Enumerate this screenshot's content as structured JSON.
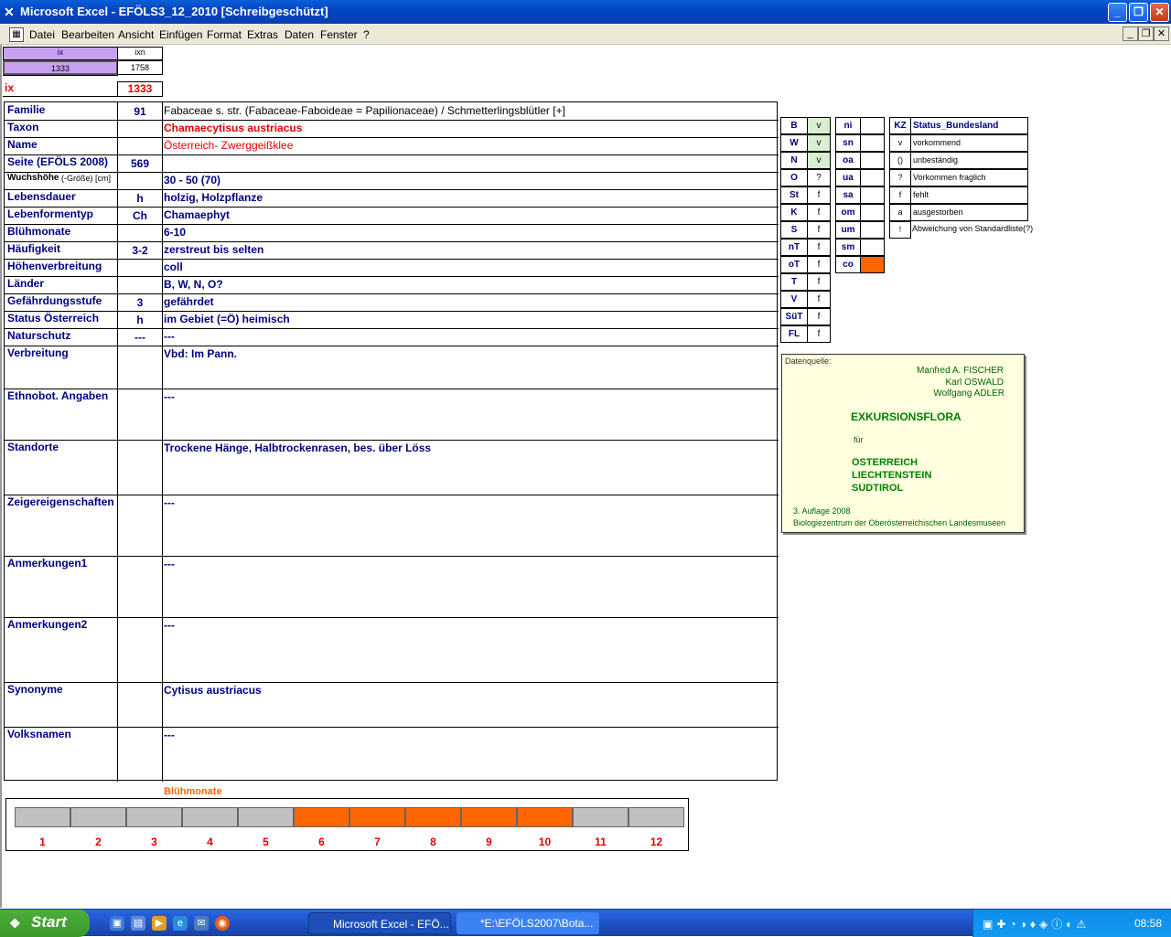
{
  "window": {
    "title": "Microsoft Excel - EFÖLS3_12_2010  [Schreibgeschützt]",
    "icon": "excel-icon"
  },
  "menu": [
    "Datei",
    "Bearbeiten",
    "Ansicht",
    "Einfügen",
    "Format",
    "Extras",
    "Daten",
    "Fenster",
    "?"
  ],
  "top": {
    "ix_label": "ix",
    "ixn_label": "ixn",
    "ix_val": "1333",
    "ixn_val": "1758",
    "ix_row_label": "ix",
    "ix_row_val": "1333"
  },
  "rows": [
    {
      "label": "Familie",
      "code": "91",
      "value": "Fabaceae s. str. (Fabaceae-Faboideae = Papilionaceae)  /  Schmetterlingsblütler [+]"
    },
    {
      "label": "Taxon",
      "code": "",
      "value": "Chamaecytisus austriacus"
    },
    {
      "label": "Name",
      "code": "",
      "value": "Österreich- Zwerggeißklee"
    },
    {
      "label": "Seite (EFÖLS 2008)",
      "code": "569",
      "value": ""
    },
    {
      "label": "Wuchshöhe",
      "label_small": "(-Größe) [cm]",
      "code": "",
      "value": " 30 - 50 (70)"
    },
    {
      "label": "Lebensdauer",
      "code": "h",
      "value": "holzig, Holzpflanze"
    },
    {
      "label": "Lebenformentyp",
      "code": "Ch",
      "value": "Chamaephyt"
    },
    {
      "label": "Blühmonate",
      "code": "",
      "value": " 6-10"
    },
    {
      "label": "Häufigkeit",
      "code": "3-2",
      "value": "zerstreut bis selten"
    },
    {
      "label": "Höhenverbreitung",
      "code": "",
      "value": "coll"
    },
    {
      "label": "Länder",
      "code": "",
      "value": "B, W, N, O?"
    },
    {
      "label": "Gefährdungsstufe",
      "code": "3",
      "value": "gefährdet"
    },
    {
      "label": "Status Österreich",
      "code": "h",
      "value": "im Gebiet (=Ö) heimisch"
    },
    {
      "label": "Naturschutz",
      "code": "---",
      "value": "---"
    },
    {
      "label": "Verbreitung",
      "code": "",
      "value": "Vbd:  Im Pann."
    },
    {
      "label": "Ethnobot. Angaben",
      "code": "",
      "value": "---"
    },
    {
      "label": "Standorte",
      "code": "",
      "value": "Trockene Hänge, Halbtrockenrasen, bes. über Löss"
    },
    {
      "label": "Zeigereigenschaften",
      "code": "",
      "value": "---"
    },
    {
      "label": "Anmerkungen1",
      "code": "",
      "value": "---"
    },
    {
      "label": "Anmerkungen2",
      "code": "",
      "value": "---"
    },
    {
      "label": "Synonyme",
      "code": "",
      "value": "Cytisus austriacus"
    },
    {
      "label": "Volksnamen",
      "code": "",
      "value": "---"
    }
  ],
  "states": [
    {
      "abbr": "B",
      "val": "v",
      "green": true
    },
    {
      "abbr": "W",
      "val": "v",
      "green": true
    },
    {
      "abbr": "N",
      "val": "v",
      "green": true
    },
    {
      "abbr": "O",
      "val": "?",
      "green": false
    },
    {
      "abbr": "St",
      "val": "f",
      "green": false
    },
    {
      "abbr": "K",
      "val": "f",
      "green": false
    },
    {
      "abbr": "S",
      "val": "f",
      "green": false
    },
    {
      "abbr": "nT",
      "val": "f",
      "green": false
    },
    {
      "abbr": "oT",
      "val": "f",
      "green": false
    },
    {
      "abbr": "T",
      "val": "f",
      "green": false
    },
    {
      "abbr": "V",
      "val": "f",
      "green": false
    },
    {
      "abbr": "SüT",
      "val": "f",
      "green": false
    },
    {
      "abbr": "FL",
      "val": "f",
      "green": false
    }
  ],
  "altitudes": [
    {
      "abbr": "ni",
      "on": false
    },
    {
      "abbr": "sn",
      "on": false
    },
    {
      "abbr": "oa",
      "on": false
    },
    {
      "abbr": "ua",
      "on": false
    },
    {
      "abbr": "sa",
      "on": false
    },
    {
      "abbr": "om",
      "on": false
    },
    {
      "abbr": "um",
      "on": false
    },
    {
      "abbr": "sm",
      "on": false
    },
    {
      "abbr": "co",
      "on": true
    }
  ],
  "kz": {
    "header_kz": "KZ",
    "header_status": "Status_Bundesland",
    "items": [
      {
        "k": "v",
        "t": "vorkommend"
      },
      {
        "k": "()",
        "t": "unbeständig"
      },
      {
        "k": "?",
        "t": "Vorkommen fraglich"
      },
      {
        "k": "f",
        "t": "fehlt"
      },
      {
        "k": "a",
        "t": "ausgestorben"
      },
      {
        "k": "!",
        "t": "Abweichung von Standardliste(?)"
      }
    ]
  },
  "source": {
    "label": "Datenquelle:",
    "authors": [
      "Manfred A. FISCHER",
      "Karl OSWALD",
      "Wolfgang ADLER"
    ],
    "title": "EXKURSIONSFLORA",
    "fuer": "für",
    "countries": [
      "ÖSTERREICH",
      "LIECHTENSTEIN",
      "SÜDTIROL"
    ],
    "edition": "3. Auflage 2008",
    "publisher": "Biologiezentrum der Oberösterreichischen Landesmuseen"
  },
  "bluehmonate": {
    "title": "Blühmonate",
    "months": [
      "1",
      "2",
      "3",
      "4",
      "5",
      "6",
      "7",
      "8",
      "9",
      "10",
      "11",
      "12"
    ],
    "active": [
      6,
      7,
      8,
      9,
      10
    ]
  },
  "taskbar": {
    "start": "Start",
    "tasks": [
      "Microsoft Excel - EFÖ...",
      "*E:\\EFÖLS2007\\Bota..."
    ],
    "clock": "08:58"
  },
  "colors": {
    "accent_orange": "#ff6600",
    "label_blue": "#000080",
    "red": "#e00000",
    "green_cell": "#d8f0d0",
    "purple_header": "#c8a0f0"
  }
}
